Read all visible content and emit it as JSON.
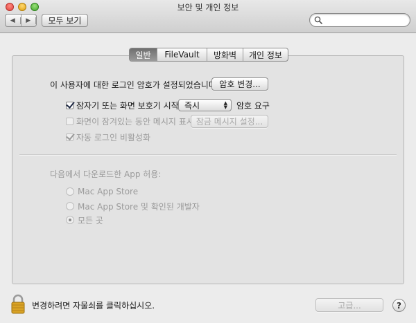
{
  "window": {
    "title": "보안 및 개인 정보"
  },
  "toolbar": {
    "back_glyph": "◀",
    "forward_glyph": "▶",
    "show_all_label": "모두 보기",
    "search_placeholder": ""
  },
  "tabs": [
    {
      "label": "일반",
      "active": true
    },
    {
      "label": "FileVault",
      "active": false
    },
    {
      "label": "방화벽",
      "active": false
    },
    {
      "label": "개인 정보",
      "active": false
    }
  ],
  "general": {
    "password_text": "이 사용자에 대한 로그인 암호가 설정되었습니다.",
    "change_password_label": "암호 변경...",
    "require_password": {
      "label": "잠자기 또는 화면 보호기 시작",
      "checked": true,
      "delay_value": "즉시",
      "suffix": "암호 요구"
    },
    "show_message": {
      "label": "화면이 잠겨있는 동안 메시지 표시",
      "checked": false,
      "disabled": true,
      "button_label": "잠금 메시지 설정..."
    },
    "disable_auto_login": {
      "label": "자동 로그인 비활성화",
      "checked": true,
      "disabled": true
    }
  },
  "gatekeeper": {
    "heading": "다음에서 다운로드한 App 허용:",
    "options": [
      {
        "label": "Mac App Store",
        "selected": false
      },
      {
        "label": "Mac App Store 및 확인된 개발자",
        "selected": false
      },
      {
        "label": "모든 곳",
        "selected": true
      }
    ]
  },
  "footer": {
    "lock_text": "변경하려면 자물쇠를 클릭하십시오.",
    "advanced_label": "고급...",
    "help_label": "?"
  }
}
